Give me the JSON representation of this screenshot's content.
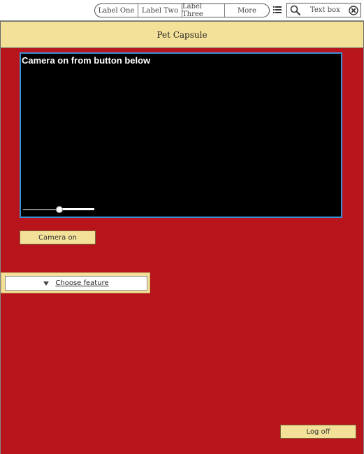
{
  "nav": {
    "labels": [
      "Label One",
      "Label Two",
      "Label Three",
      "More"
    ],
    "search_placeholder": "Text box"
  },
  "header": {
    "title": "Pet Capsule"
  },
  "video": {
    "caption": "Camera on from button below",
    "slider_level": 0.5
  },
  "buttons": {
    "camera_on": "Camera on",
    "log_off": "Log off"
  },
  "feature": {
    "selected": "Choose feature"
  },
  "colors": {
    "panel": "#b8141b",
    "accent": "#f4e199",
    "video_border": "#3a8fd6"
  }
}
